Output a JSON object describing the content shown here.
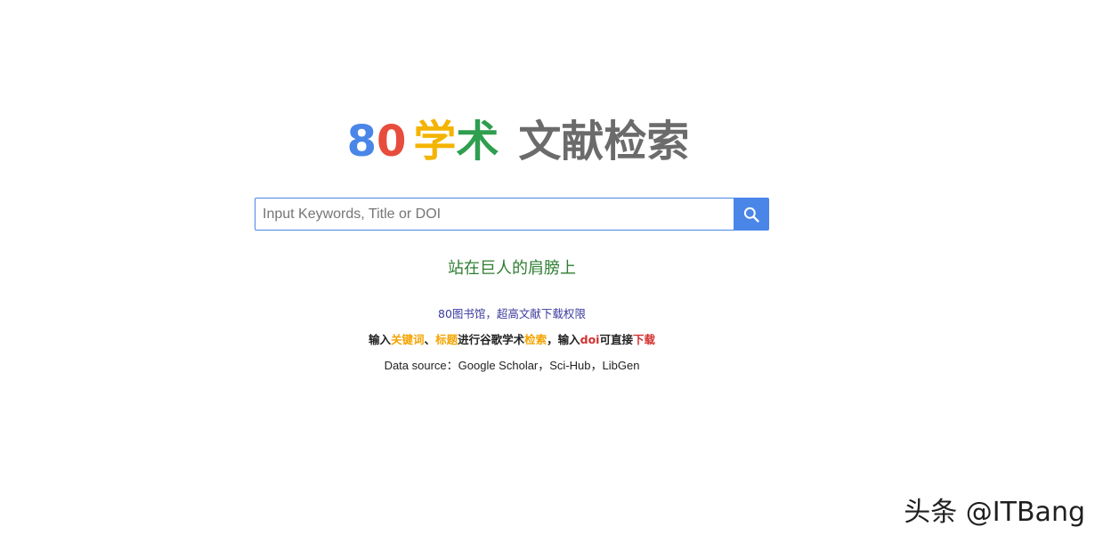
{
  "logo": {
    "part1": "8",
    "part2": "0",
    "part3": "学",
    "part4": "术",
    "part5": "文献检索",
    "colors": {
      "blue": "#4a86e8",
      "red": "#e74c3c",
      "yellow": "#f4b400",
      "green": "#2e9e4f",
      "gray": "#6b6b6b"
    }
  },
  "search": {
    "placeholder": "Input Keywords, Title or DOI",
    "value": "",
    "button_icon": "search-icon"
  },
  "slogan": "站在巨人的肩膀上",
  "info": {
    "line1": "80图书馆，超高文献下载权限",
    "line2": {
      "t1": "输入",
      "t2": "关键词",
      "t3": "、",
      "t4": "标题",
      "t5": "进行谷歌学术",
      "t6": "检索",
      "t7": "，输入",
      "t8": "doi",
      "t9": "可直接",
      "t10": "下载"
    },
    "line3": "Data source：Google Scholar，Sci-Hub，LibGen"
  },
  "watermark": "头条 @ITBang"
}
